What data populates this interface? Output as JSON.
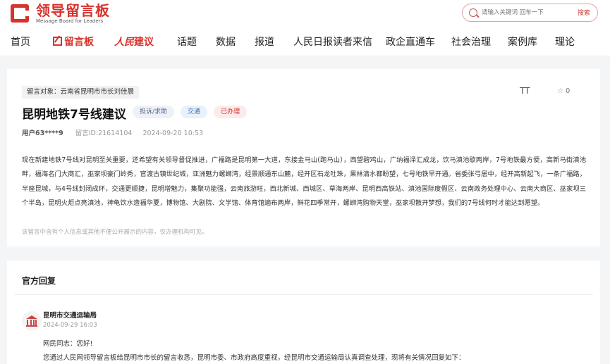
{
  "brand": {
    "name_cn": "领导留言板",
    "name_en": "Message Board for Leaders"
  },
  "search": {
    "placeholder": "请输入关键词 回车一下",
    "button": "搜索"
  },
  "nav": {
    "items": [
      "首页",
      "留言板",
      "建议",
      "话题",
      "数据",
      "报道",
      "人民日报读者来信",
      "政企直通车",
      "社会治理",
      "案例库",
      "理论"
    ],
    "rmrb_logo": "人民"
  },
  "message": {
    "target": "留言对象：云南省昆明市市长刘佳晨",
    "title": "昆明地铁7号线建议",
    "tags": [
      "投诉/求助",
      "交通",
      "已办理"
    ],
    "user": "用户63****9",
    "msg_id": "留言ID:21614104",
    "date": "2024-09-20 10:53",
    "font_tool": "TT",
    "fav_count": "0",
    "body": "现在新建地铁7号线对昆明至关重要，还希望有关领导督促推进，广福路是昆明第一大道，东接金马山(跑马山），西望碧鸡山，广纳福泽汇成龙，饮马滇池歇两岸，7号地铁最方便，高新马街滇池畔，福海名门大商汇，巫家坝豪门岭秀，官渡古镇世纪城，亚洲魅力螺蛳湾，经景顺通东山麓，经开区石龙吐珠，果林清水都盼望，七号地铁早开通。省委张弓居中，经开高新起飞，一条广福路，半座昆城，与4号线封闭成环，交通更顺捷，昆明增魅力，集聚功能强，云南旅游旺，西北新城、西城区、草海两岸、昆明西高铁站、滇池国际度假区、云南政务处理中心、云南大商区、巫家坝三个半岛，昆明火炬点亮滇池，神龟饮水造福华夏，博物馆、大剧院、文学馆、体育馆遍布两岸，鲜花四季常开，螺蛳湾购物天堂，巫家坝散开梦想，我们的7号线何时才能达到愿望。",
    "notice": "该留言中含有个人信息或其他不便公开展示的内容，仅办理机构可见。"
  },
  "reply": {
    "heading": "官方回复",
    "org": "昆明市交通运输局",
    "date": "2024-09-29 16:03",
    "greeting": "网民同志：您好!",
    "text": "您通过人民网领导留言板给昆明市市长的留言收悉，昆明市委、市政府高度重视，经昆明市交通运输局认真调查处理，现将有关情况回复如下："
  }
}
